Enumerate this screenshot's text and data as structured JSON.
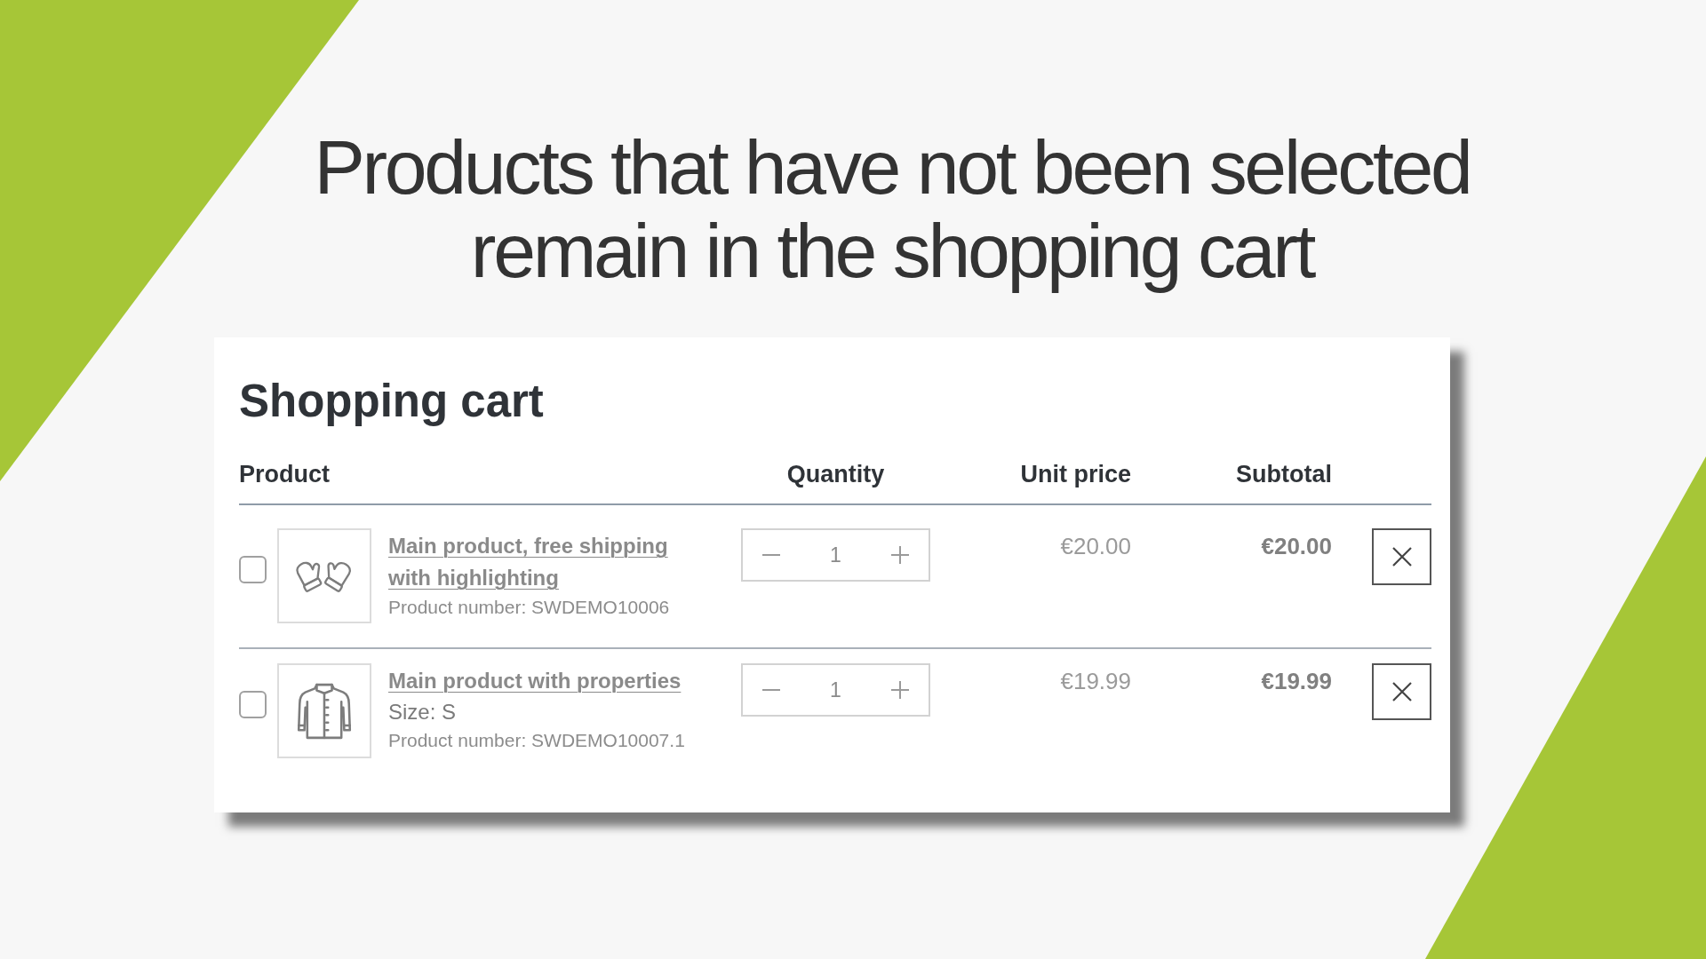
{
  "slide": {
    "title": "Products that have not been selected remain in the shopping cart"
  },
  "cart": {
    "title": "Shopping cart",
    "columns": [
      "Product",
      "Quantity",
      "Unit price",
      "Subtotal"
    ],
    "items": [
      {
        "checked": false,
        "name": "Main product, free shipping with highlighting",
        "product_number": "Product number: SWDEMO10006",
        "quantity": "1",
        "unit_price": "€20.00",
        "subtotal": "€20.00"
      },
      {
        "checked": false,
        "name": "Main product with properties",
        "properties": [
          "Size: S"
        ],
        "product_number": "Product number: SWDEMO10007.1",
        "quantity": "1",
        "unit_price": "€19.99",
        "subtotal": "€19.99"
      }
    ]
  }
}
